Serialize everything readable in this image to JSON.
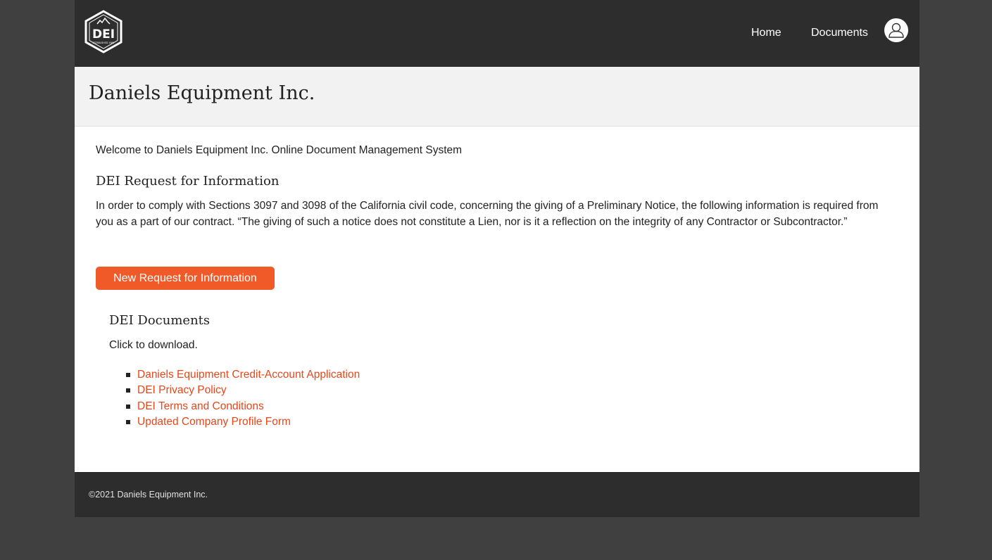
{
  "header": {
    "logo_text": "DEI",
    "logo_subtext": "ESTABLISHED 1980",
    "nav": {
      "home": "Home",
      "documents": "Documents"
    },
    "avatar_icon": "user-icon"
  },
  "title_band": {
    "title": "Daniels Equipment Inc."
  },
  "main": {
    "welcome": "Welcome to Daniels Equipment Inc. Online Document Management System",
    "rfi": {
      "heading": "DEI Request for Information",
      "body": "In order to comply with Sections 3097 and 3098 of the California civil code, concerning the giving of a Preliminary Notice, the following information is required from you as a part of our contract. “The giving of such a notice does not constitute a Lien, nor is it a reflection on the integrity of any Contractor or Subcontractor.”",
      "button_label": "New Request for Information"
    },
    "documents": {
      "heading": "DEI Documents",
      "subtext": "Click to download.",
      "items": [
        {
          "label": "Daniels Equipment Credit-Account Application"
        },
        {
          "label": "DEI Privacy Policy"
        },
        {
          "label": "DEI Terms and Conditions"
        },
        {
          "label": "Updated Company Profile Form"
        }
      ]
    }
  },
  "footer": {
    "copyright": "©2021 Daniels Equipment Inc."
  },
  "colors": {
    "accent": "#f05a28",
    "link": "#e8461b",
    "header_bg": "#2d2d2d",
    "page_bg": "#404040",
    "title_band_bg": "#f2f2f2"
  }
}
